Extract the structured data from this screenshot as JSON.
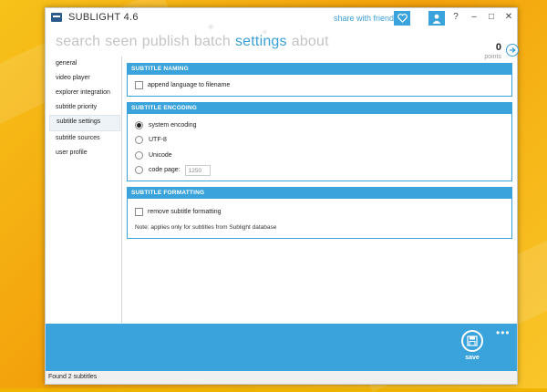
{
  "window": {
    "title": "SUBLIGHT 4.6",
    "share_label": "share with friends",
    "help_label": "?",
    "minimize_label": "–",
    "maximize_label": "□",
    "close_label": "✕"
  },
  "nav": {
    "tabs": [
      {
        "label": "search",
        "active": false
      },
      {
        "label": "seen",
        "active": false
      },
      {
        "label": "publish",
        "active": false
      },
      {
        "label": "batch",
        "active": false
      },
      {
        "label": "settings",
        "active": true
      },
      {
        "label": "about",
        "active": false
      }
    ]
  },
  "points": {
    "value": "0",
    "label": "points"
  },
  "sidebar": {
    "items": [
      {
        "label": "general"
      },
      {
        "label": "video player"
      },
      {
        "label": "explorer integration"
      },
      {
        "label": "subtitle priority"
      },
      {
        "label": "subtitle settings",
        "active": true
      },
      {
        "label": "subtitle sources"
      },
      {
        "label": "user profile"
      }
    ]
  },
  "sections": {
    "naming": {
      "title": "SUBTITLE NAMING",
      "append_label": "append language to filename",
      "append_checked": false
    },
    "encoding": {
      "title": "SUBTITLE ENCODING",
      "options": [
        {
          "label": "system encoding",
          "checked": true
        },
        {
          "label": "UTF-8",
          "checked": false
        },
        {
          "label": "Unicode",
          "checked": false
        },
        {
          "label": "code page:",
          "checked": false
        }
      ],
      "code_page_value": "1250"
    },
    "formatting": {
      "title": "SUBTITLE FORMATTING",
      "remove_label": "remove subtitle formatting",
      "remove_checked": false,
      "note": "Note: applies only for subtitles from Sublight database"
    }
  },
  "bottom": {
    "save_label": "save",
    "more_label": "•••"
  },
  "status": {
    "text": "Found 2 subtitles"
  },
  "colors": {
    "accent": "#3aa3dc",
    "inactive_tab": "#c4c4c4",
    "desktop": "#f3a10b"
  },
  "icons": [
    "heart-icon",
    "user-icon",
    "arrow-right-icon",
    "save-icon",
    "snowflake-icon"
  ]
}
